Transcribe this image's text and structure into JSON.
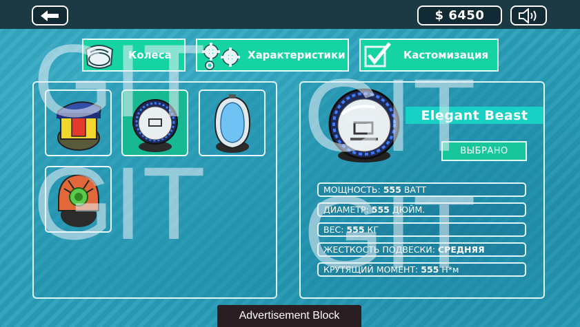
{
  "header": {
    "back_icon": "arrow-left-icon",
    "money": "$ 6450",
    "sound_icon": "speaker-icon"
  },
  "tabs": [
    {
      "label": "Колеса",
      "icon": "wheel-icon"
    },
    {
      "label": "Характеристики",
      "icon": "gears-icon"
    },
    {
      "label": "Кастомизация",
      "icon": "checkbox-icon"
    }
  ],
  "inventory": {
    "items": [
      {
        "icon": "hat-wheel-icon",
        "selected": false
      },
      {
        "icon": "elegant-beast-wheel-icon",
        "selected": true
      },
      {
        "icon": "blue-wheel-icon",
        "selected": false
      },
      {
        "icon": "orange-wheel-icon",
        "selected": false
      }
    ]
  },
  "details": {
    "name": "Elegant Beast",
    "status_button": "ВЫБРАНО",
    "stats": [
      {
        "label": "МОЩНОСТЬ:",
        "value": "555",
        "unit": "ВАТТ"
      },
      {
        "label": "ДИАМЕТР:",
        "value": "555",
        "unit": "ДЮЙМ."
      },
      {
        "label": "ВЕС:",
        "value": "555",
        "unit": "КГ"
      },
      {
        "label": "ЖЕСТКОСТЬ ПОДВЕСКИ:",
        "value": "СРЕДНЯЯ",
        "unit": ""
      },
      {
        "label": "КРУТЯЩИЙ МОМЕНТ:",
        "value": "555",
        "unit": "Н*м"
      }
    ]
  },
  "watermark": "GIT",
  "ad": {
    "label": "Advertisement Block"
  },
  "colors": {
    "accent": "#15d3a2",
    "banner": "#19d0c4",
    "topbar": "#1b3a44",
    "background": "#2a9fba"
  }
}
